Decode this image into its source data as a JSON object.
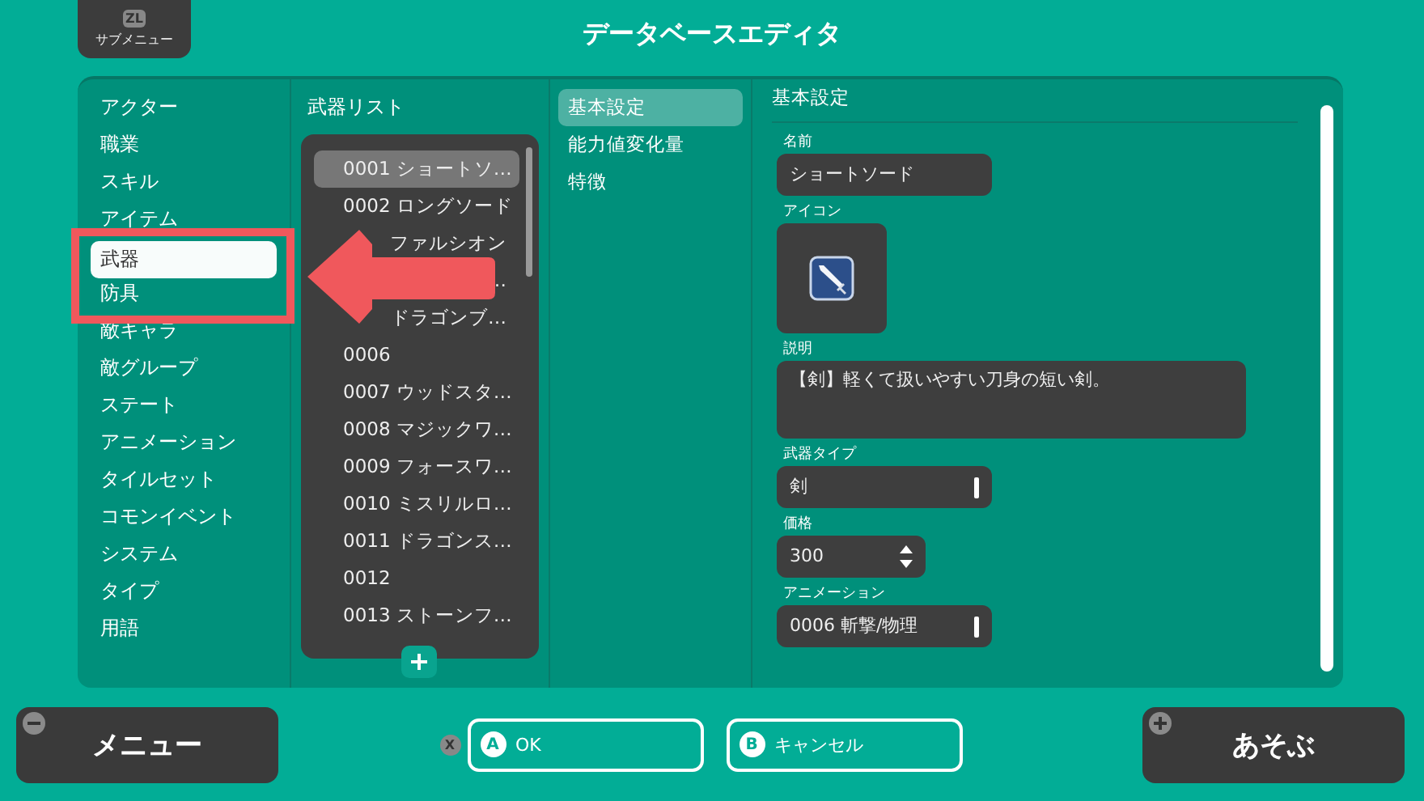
{
  "header": {
    "submenu": {
      "key": "ZL",
      "label": "サブメニュー"
    },
    "title": "データベースエディタ"
  },
  "categories": [
    {
      "label": "アクター",
      "selected": false
    },
    {
      "label": "職業",
      "selected": false
    },
    {
      "label": "スキル",
      "selected": false
    },
    {
      "label": "アイテム",
      "selected": false
    },
    {
      "label": "武器",
      "selected": true
    },
    {
      "label": "防具",
      "selected": false
    },
    {
      "label": "敵キャラ",
      "selected": false
    },
    {
      "label": "敵グループ",
      "selected": false
    },
    {
      "label": "ステート",
      "selected": false
    },
    {
      "label": "アニメーション",
      "selected": false
    },
    {
      "label": "タイルセット",
      "selected": false
    },
    {
      "label": "コモンイベント",
      "selected": false
    },
    {
      "label": "システム",
      "selected": false
    },
    {
      "label": "タイプ",
      "selected": false
    },
    {
      "label": "用語",
      "selected": false
    }
  ],
  "weapon_list": {
    "title": "武器リスト",
    "items": [
      {
        "number": "0001",
        "name": "ショートソ…",
        "selected": true
      },
      {
        "number": "0002",
        "name": "ロングソード",
        "selected": false
      },
      {
        "name": "ファルシオン",
        "selected": false
      },
      {
        "name": "…",
        "selected": false
      },
      {
        "name": "ドラゴンブ…",
        "selected": false
      },
      {
        "number": "0006",
        "selected": false
      },
      {
        "number": "0007",
        "name": "ウッドスタ…",
        "selected": false
      },
      {
        "number": "0008",
        "name": "マジックワ…",
        "selected": false
      },
      {
        "number": "0009",
        "name": "フォースワ…",
        "selected": false
      },
      {
        "number": "0010",
        "name": "ミスリルロ…",
        "selected": false
      },
      {
        "number": "0011",
        "name": "ドラゴンス…",
        "selected": false
      },
      {
        "number": "0012",
        "selected": false
      },
      {
        "number": "0013",
        "name": "ストーンフ…",
        "selected": false
      }
    ]
  },
  "tabs": [
    {
      "label": "基本設定",
      "selected": true
    },
    {
      "label": "能力値変化量",
      "selected": false
    },
    {
      "label": "特徴",
      "selected": false
    }
  ],
  "detail": {
    "title": "基本設定",
    "fields": [
      {
        "kind": "text",
        "label": "名前",
        "value": "ショートソード"
      },
      {
        "kind": "icon",
        "label": "アイコン"
      },
      {
        "kind": "textarea",
        "label": "説明",
        "value": "【剣】軽くて扱いやすい刀身の短い剣。"
      },
      {
        "kind": "select",
        "label": "武器タイプ",
        "value": "剣"
      },
      {
        "kind": "number",
        "label": "価格",
        "value": "300"
      },
      {
        "kind": "select",
        "label": "アニメーション",
        "value": "0006 斬撃/物理"
      }
    ]
  },
  "footer": {
    "menu": "メニュー",
    "x_key": "X",
    "ok": {
      "key": "A",
      "label": "OK"
    },
    "cancel": {
      "key": "B",
      "label": "キャンセル"
    },
    "play": "あそぶ"
  }
}
